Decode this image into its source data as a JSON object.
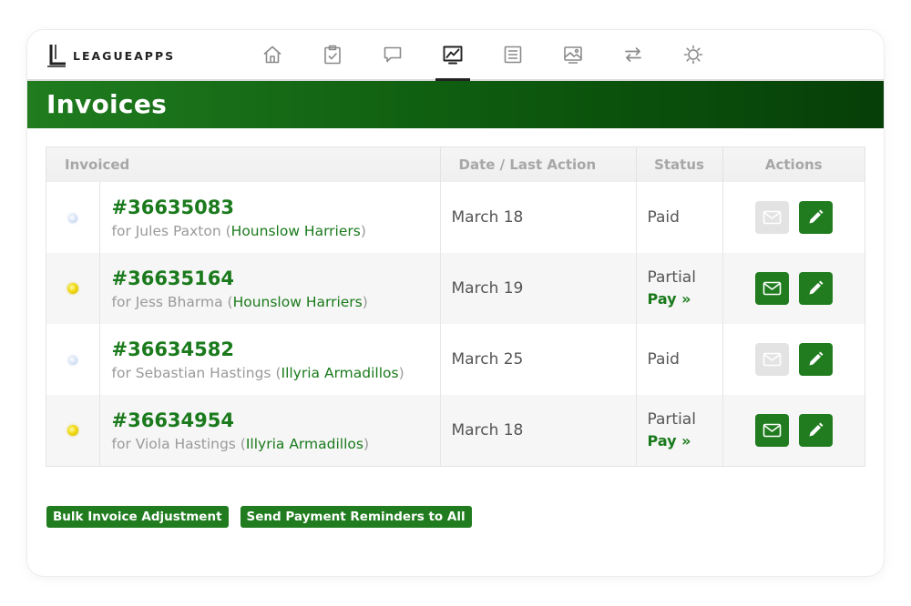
{
  "app": {
    "logo_text": "LEAGUEAPPS"
  },
  "nav": {
    "items": [
      {
        "icon": "home-icon"
      },
      {
        "icon": "clipboard-check-icon"
      },
      {
        "icon": "chat-icon"
      },
      {
        "icon": "chart-icon",
        "active": true
      },
      {
        "icon": "list-icon"
      },
      {
        "icon": "image-icon"
      },
      {
        "icon": "transfer-icon"
      },
      {
        "icon": "gear-icon"
      }
    ]
  },
  "page": {
    "title": "Invoices"
  },
  "table": {
    "headers": {
      "invoiced": "Invoiced",
      "date": "Date / Last Action",
      "status": "Status",
      "actions": "Actions"
    },
    "rows": [
      {
        "number": "#36635083",
        "for_prefix": "for Jules Paxton (",
        "team": "Hounslow Harriers",
        "for_suffix": ")",
        "date": "March 18",
        "status": "Paid",
        "pay": "",
        "indicator": "blue",
        "email_enabled": false
      },
      {
        "number": "#36635164",
        "for_prefix": "for Jess Bharma (",
        "team": "Hounslow Harriers",
        "for_suffix": ")",
        "date": "March 19",
        "status": "Partial",
        "pay": "Pay »",
        "indicator": "yellow",
        "email_enabled": true
      },
      {
        "number": "#36634582",
        "for_prefix": "for Sebastian Hastings (",
        "team": "Illyria Armadillos",
        "for_suffix": ")",
        "date": "March 25",
        "status": "Paid",
        "pay": "",
        "indicator": "blue",
        "email_enabled": false
      },
      {
        "number": "#36634954",
        "for_prefix": "for Viola Hastings (",
        "team": "Illyria Armadillos",
        "for_suffix": ")",
        "date": "March 18",
        "status": "Partial",
        "pay": "Pay »",
        "indicator": "yellow",
        "email_enabled": true
      }
    ]
  },
  "footer_buttons": {
    "bulk_adjustment": "Bulk Invoice Adjustment",
    "send_reminders": "Send Payment Reminders to All"
  },
  "colors": {
    "brand_green": "#207c1f",
    "link_green": "#1a7a1c",
    "disabled_grey": "#e3e3e3",
    "partial_yellow": "#f0da12",
    "paid_blue": "#b7c9ea"
  }
}
